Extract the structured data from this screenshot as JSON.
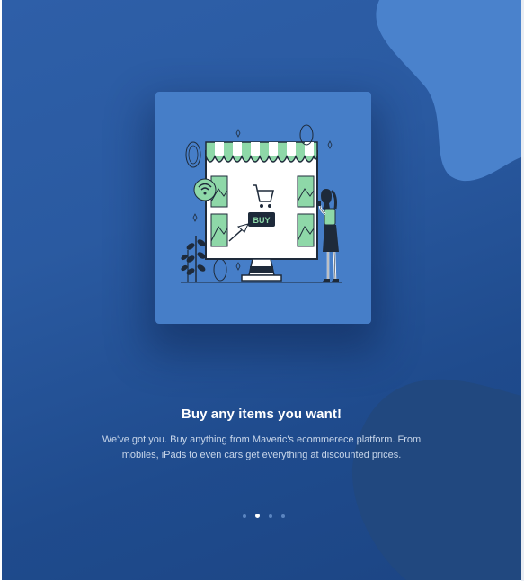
{
  "onboarding": {
    "slide_title": "Buy any items you want!",
    "slide_description": "We've got you. Buy anything from Maveric's ecommerece platform. From mobiles, iPads to even cars get everything at discounted prices.",
    "illustration": {
      "button_label": "BUY",
      "icons": [
        "dollar-coin-icon",
        "wifi-icon",
        "shopping-cart-icon",
        "cursor-arrow-icon",
        "plant-icon"
      ]
    },
    "pagination": {
      "total": 4,
      "active_index": 1
    }
  },
  "colors": {
    "background": "#2a5aa1",
    "blob": "#4a82cc",
    "blob_dark": "#21487f",
    "card": "#467ec8",
    "accent_green": "#8ed8a8",
    "dot_active": "#ffffff",
    "dot_inactive": "#5b85c0"
  }
}
